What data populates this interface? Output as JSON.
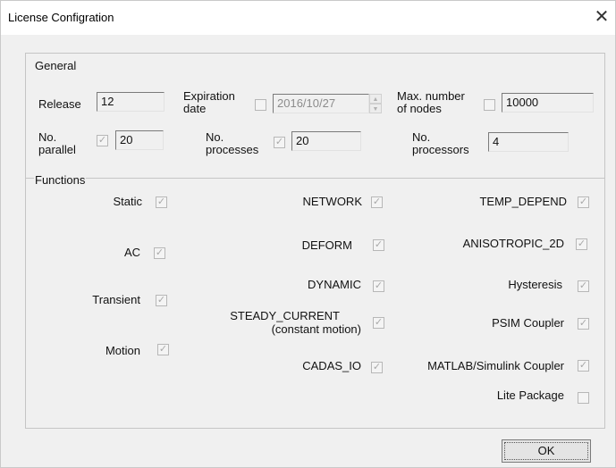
{
  "window": {
    "title": "License Configration"
  },
  "general": {
    "group_label": "General",
    "release_label": "Release",
    "release_value": "12",
    "expiration_label_1": "Expiration",
    "expiration_label_2": "date",
    "expiration_value": "2016/10/27",
    "max_nodes_label_1": "Max. number",
    "max_nodes_label_2": "of nodes",
    "max_nodes_value": "10000",
    "parallel_label_1": "No.",
    "parallel_label_2": "parallel",
    "parallel_value": "20",
    "processes_label_1": "No.",
    "processes_label_2": "processes",
    "processes_value": "20",
    "processors_label_1": "No.",
    "processors_label_2": "processors",
    "processors_value": "4"
  },
  "functions": {
    "group_label": "Functions",
    "static": "Static",
    "ac": "AC",
    "transient": "Transient",
    "motion": "Motion",
    "network": "NETWORK",
    "deform": "DEFORM",
    "dynamic": "DYNAMIC",
    "steady_current_1": "STEADY_CURRENT",
    "steady_current_2": "(constant motion)",
    "cadas_io": "CADAS_IO",
    "temp_depend": "TEMP_DEPEND",
    "anisotropic_2d": "ANISOTROPIC_2D",
    "hysteresis": "Hysteresis",
    "psim_coupler": "PSIM Coupler",
    "matlab_coupler": "MATLAB/Simulink Coupler",
    "lite_package": "Lite Package"
  },
  "checkbox_states": {
    "expiration": false,
    "max_nodes": false,
    "parallel": true,
    "processes": true,
    "static": true,
    "ac": true,
    "transient": true,
    "motion": true,
    "network": true,
    "deform": true,
    "dynamic": true,
    "steady_current": true,
    "cadas_io": true,
    "temp_depend": true,
    "anisotropic_2d": true,
    "hysteresis": true,
    "psim_coupler": true,
    "matlab_coupler": true,
    "lite_package": false
  },
  "check_glyph": "✓",
  "buttons": {
    "ok": "OK"
  }
}
